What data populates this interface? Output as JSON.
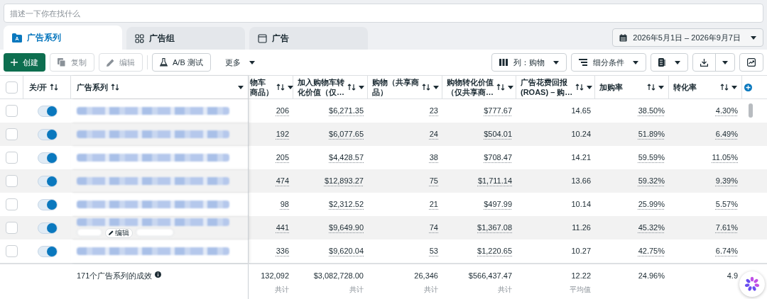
{
  "search": {
    "placeholder": "描述一下你在找什么"
  },
  "tabs": [
    {
      "label": "广告系列",
      "kind": "campaign",
      "selected": true
    },
    {
      "label": "广告组",
      "kind": "adset",
      "selected": false
    },
    {
      "label": "广告",
      "kind": "ad",
      "selected": false
    }
  ],
  "date_range": "2026年5月1日 – 2026年9月7日",
  "toolbar": {
    "left": [
      {
        "label": "创建",
        "kind": "create",
        "disabled": false
      },
      {
        "label": "复制",
        "kind": "copy",
        "disabled": true
      },
      {
        "label": "编辑",
        "kind": "edit",
        "disabled": true
      },
      {
        "label": "A/B 测试",
        "kind": "abtest",
        "disabled": false
      },
      {
        "label": "更多",
        "kind": "more",
        "disabled": false
      }
    ],
    "right": [
      {
        "label": "列：购物",
        "kind": "columns"
      },
      {
        "label": "细分条件",
        "kind": "breakdown"
      },
      {
        "kind": "reports"
      },
      {
        "kind": "export"
      },
      {
        "kind": "chart"
      }
    ]
  },
  "table": {
    "all_checked": false,
    "fixed_columns": [
      "关/开",
      "广告系列"
    ],
    "columns": [
      {
        "label": "物车商品）",
        "underline": true
      },
      {
        "label": "加入购物车转化价值（仅…",
        "underline": true
      },
      {
        "label": "购物（共享商品）",
        "underline": true
      },
      {
        "label": "购物转化价值（仅共享商…",
        "underline": true
      },
      {
        "label": "广告花费回报(ROAS) – 购…",
        "underline": false
      },
      {
        "label": "加购率",
        "underline": true
      },
      {
        "label": "转化率",
        "underline": true
      }
    ],
    "rows": [
      {
        "checked": false,
        "on": true,
        "values": [
          "206",
          "$6,271.35",
          "23",
          "$777.67",
          "14.65",
          "38.50%",
          "4.30%"
        ]
      },
      {
        "checked": false,
        "on": true,
        "values": [
          "192",
          "$6,077.65",
          "24",
          "$504.01",
          "10.24",
          "51.89%",
          "6.49%"
        ]
      },
      {
        "checked": false,
        "on": true,
        "values": [
          "205",
          "$4,428.57",
          "38",
          "$708.47",
          "14.21",
          "59.59%",
          "11.05%"
        ]
      },
      {
        "checked": false,
        "on": true,
        "values": [
          "474",
          "$12,893.27",
          "75",
          "$1,711.14",
          "13.66",
          "59.32%",
          "9.39%"
        ]
      },
      {
        "checked": false,
        "on": true,
        "values": [
          "98",
          "$2,312.52",
          "21",
          "$497.99",
          "10.14",
          "25.99%",
          "5.57%"
        ]
      },
      {
        "checked": false,
        "on": true,
        "values": [
          "441",
          "$9,649.90",
          "74",
          "$1,367.08",
          "11.26",
          "45.32%",
          "7.61%"
        ],
        "actions": [
          "编辑"
        ]
      },
      {
        "checked": false,
        "on": true,
        "values": [
          "336",
          "$9,620.04",
          "53",
          "$1,220.65",
          "10.27",
          "42.75%",
          "6.74%"
        ]
      }
    ],
    "summary": {
      "label": "171个广告系列的成效",
      "totals": [
        {
          "value": "132,092",
          "note": "共计"
        },
        {
          "value": "$3,082,728.00",
          "note": "共计"
        },
        {
          "value": "26,346",
          "note": "共计"
        },
        {
          "value": "$566,437.47",
          "note": "共计"
        },
        {
          "value": "12.22",
          "note": "平均值"
        },
        {
          "value": "24.96%"
        },
        {
          "value": "4.9"
        }
      ]
    }
  }
}
